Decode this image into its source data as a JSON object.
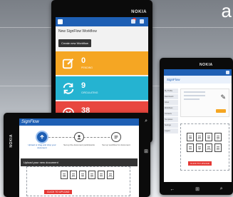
{
  "background": {
    "partial_glyph": "a"
  },
  "phone_center": {
    "brand": "NOKIA",
    "header": {
      "title": "New SignFlow Workflow",
      "button": "Create new Workflow"
    },
    "tiles": [
      {
        "count": "0",
        "label": "PENDING",
        "icon": "edit-icon",
        "color": "#f5a623"
      },
      {
        "count": "9",
        "label": "CIRCULATING",
        "icon": "refresh-icon",
        "color": "#25b3d1"
      },
      {
        "count": "38",
        "label": "CANCELED",
        "icon": "close-circle-icon",
        "color": "#e8473f"
      }
    ]
  },
  "phone_right": {
    "brand": "NOKIA",
    "title": "SignFlow",
    "side_items": [
      "My Profile",
      "Dashboard",
      "Inbox",
      "Workflows",
      "Contacts",
      "Templates",
      "Settings",
      "Logout"
    ],
    "file_types": [
      "pdf",
      "doc",
      "xls",
      "ppt",
      "txt",
      "rtf",
      "png",
      "jpg"
    ],
    "button": "CLICK TO UPLOAD"
  },
  "phone_landscape": {
    "brand": "NOKIA",
    "app_name": "SignFlow",
    "steps": [
      {
        "label": "Upload or drag and drop your document",
        "active": true
      },
      {
        "label": "Set up the document participants",
        "active": false
      },
      {
        "label": "Set up workflow for document",
        "active": false
      }
    ],
    "upload_header": "Upload your new document",
    "file_types": [
      "pdf",
      "doc",
      "xls",
      "ppt",
      "txt",
      "png"
    ],
    "button": "CLICK TO UPLOAD"
  }
}
